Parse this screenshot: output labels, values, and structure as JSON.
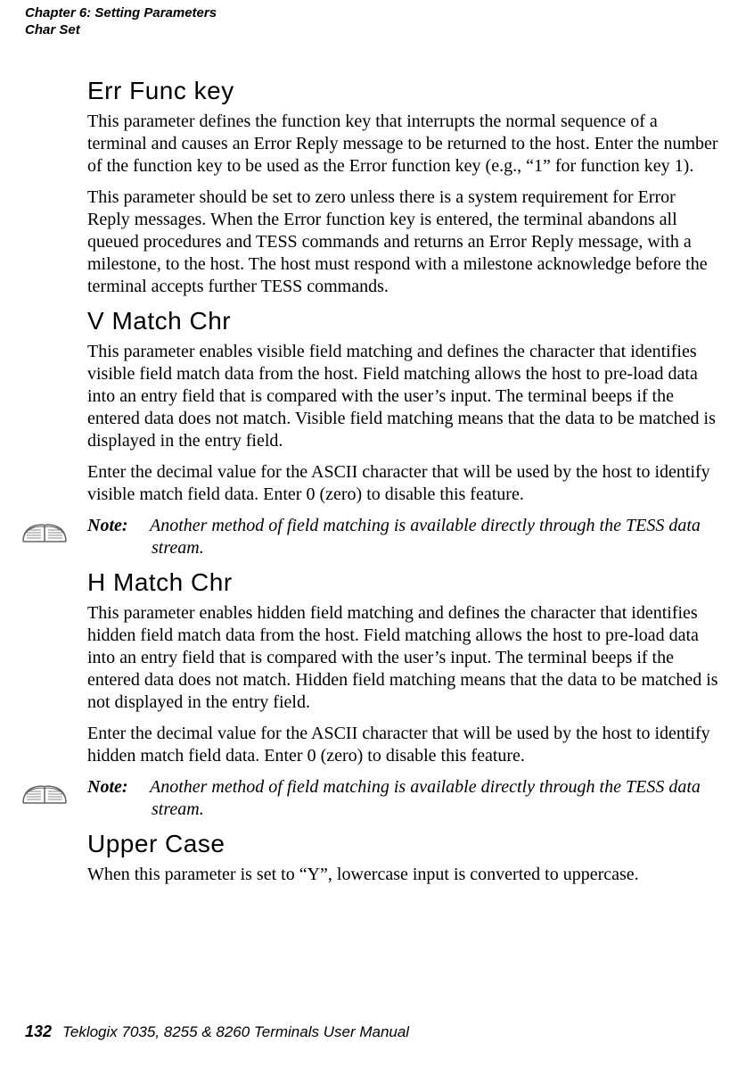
{
  "header": {
    "chapter_line": "Chapter  6:  Setting Parameters",
    "section_line": "Char Set"
  },
  "sections": {
    "err_func_key": {
      "heading": "Err Func key",
      "p1": "This parameter defines the function key that interrupts the normal sequence of a terminal and causes an Error Reply message to be returned to the host. Enter the number of the function key to be used as the Error function key (e.g., “1” for function key 1).",
      "p2": "This parameter should be set to zero unless there is a system requirement for Error Reply messages. When the Error function key is entered, the terminal abandons all queued procedures and TESS commands and returns an Error Reply message, with a milestone, to the host. The host must respond with a milestone acknowledge before the terminal accepts further TESS commands."
    },
    "v_match_chr": {
      "heading": "V Match Chr",
      "p1": "This parameter enables visible field matching and defines the character that identifies visible field match data from the host. Field matching allows the host to pre-load data into an entry field that is compared with the user’s input. The terminal beeps if the entered data does not match. Visible field matching means that the data to be matched is displayed in the entry field.",
      "p2": "Enter the decimal value for the ASCII character that will be used by the host to identify visible match field data. Enter 0 (zero) to disable this feature.",
      "note_label": "Note:",
      "note_text": "Another method of field matching is available directly through the TESS data stream."
    },
    "h_match_chr": {
      "heading": "H Match Chr",
      "p1": "This parameter enables hidden field matching and defines the character that identifies hidden field match data from the host. Field matching allows the host to pre-load data into an entry field that is compared with the user’s input. The terminal beeps if the entered data does not match. Hidden field matching means that the data to be matched is not displayed in the entry field.",
      "p2": "Enter the decimal value for the ASCII character that will be used by the host to identify hidden match field data. Enter 0 (zero) to disable this feature.",
      "note_label": "Note:",
      "note_text": "Another method of field matching is available directly through the TESS data stream."
    },
    "upper_case": {
      "heading": "Upper Case",
      "p1": "When this parameter is set to “Y”, lowercase input is converted to uppercase."
    }
  },
  "footer": {
    "page_number": "132",
    "manual_title": "Teklogix 7035, 8255 & 8260 Terminals User Manual"
  }
}
